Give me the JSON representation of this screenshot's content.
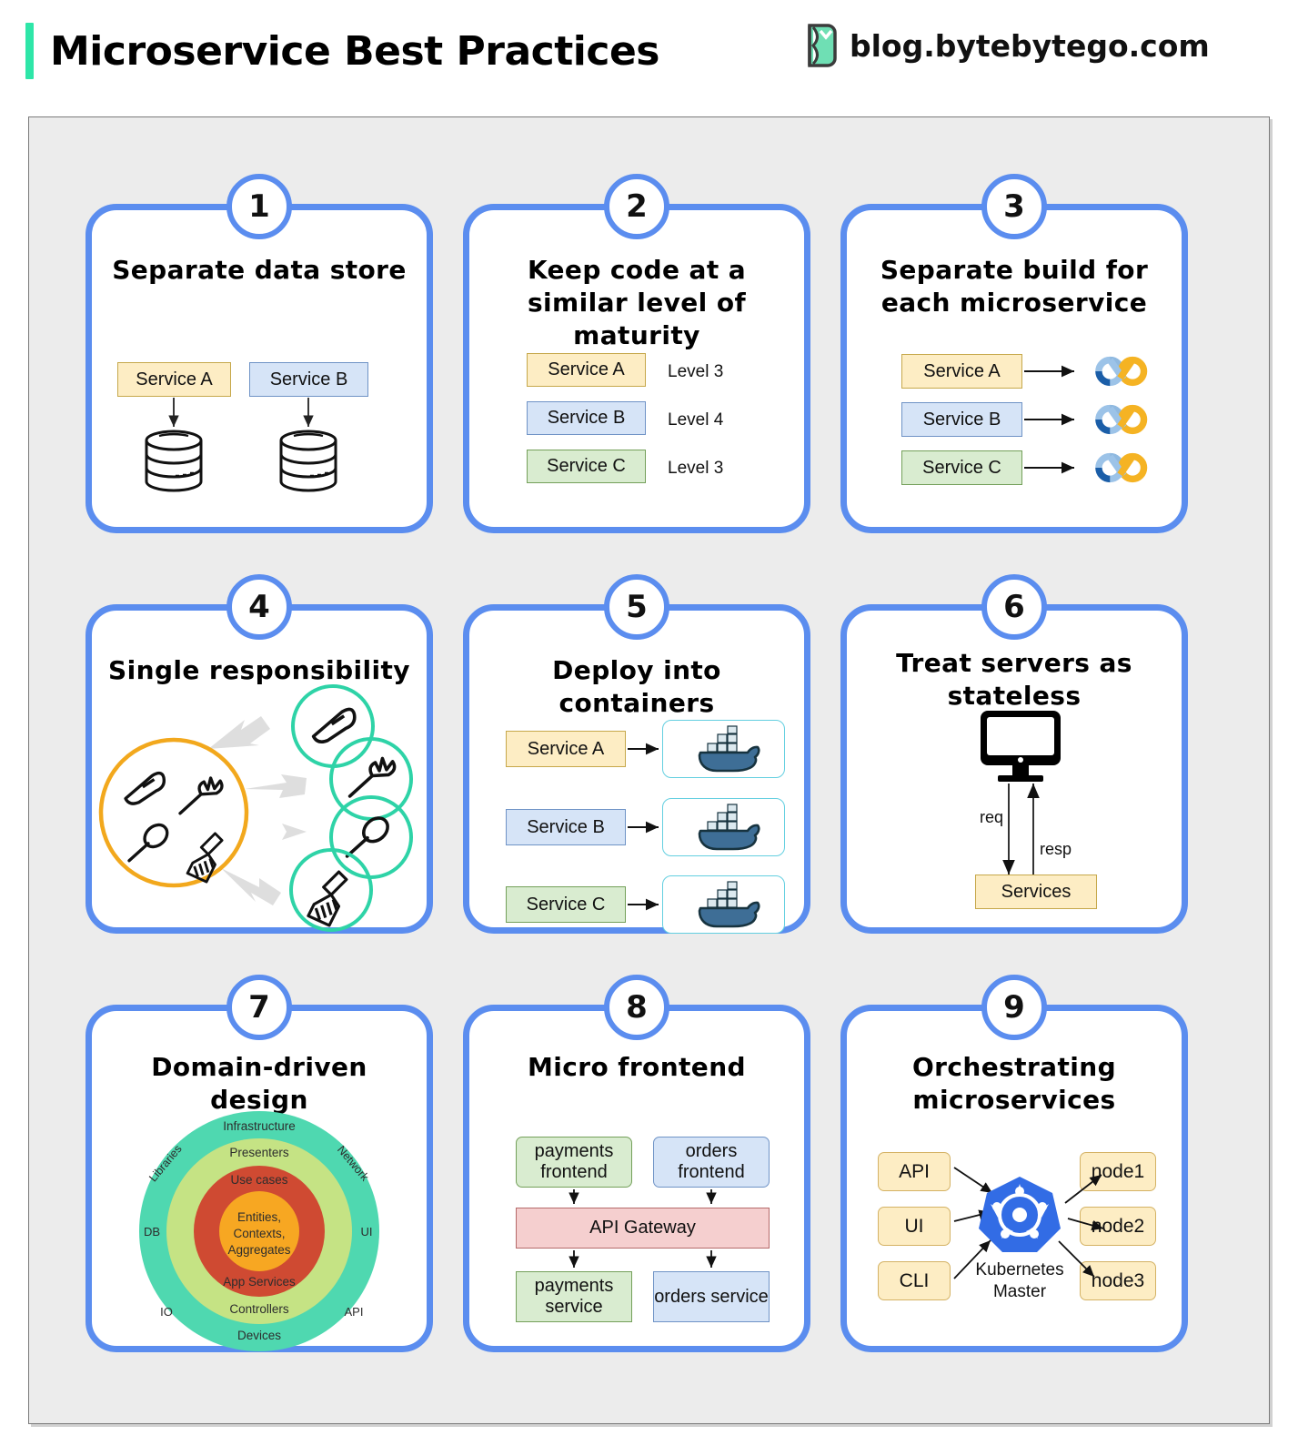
{
  "header": {
    "title": "Microservice Best Practices",
    "brand_text": "blog.bytebytego.com",
    "logo_icon": "bytebytego-logo-icon",
    "accent_color": "#2ee6a8"
  },
  "theme": {
    "card_border": "#5b8def",
    "frame_bg": "#ececec",
    "yellow": "#fdedc4",
    "blue": "#d6e4f7",
    "green": "#d9ecd0",
    "red": "#f5cfcf"
  },
  "cards": [
    {
      "number": "1",
      "title": "Separate data store",
      "services": [
        {
          "label": "Service A",
          "color": "yellow"
        },
        {
          "label": "Service B",
          "color": "blue"
        }
      ],
      "icons": [
        "database-cylinder-icon",
        "database-cylinder-icon"
      ]
    },
    {
      "number": "2",
      "title": "Keep code at a similar level of maturity",
      "rows": [
        {
          "label": "Service A",
          "color": "yellow",
          "level": "Level 3"
        },
        {
          "label": "Service B",
          "color": "blue",
          "level": "Level 4"
        },
        {
          "label": "Service C",
          "color": "green",
          "level": "Level 3"
        }
      ]
    },
    {
      "number": "3",
      "title": "Separate build for each microservice",
      "rows": [
        {
          "label": "Service A",
          "color": "yellow",
          "icon": "cicd-infinity-icon"
        },
        {
          "label": "Service B",
          "color": "blue",
          "icon": "cicd-infinity-icon"
        },
        {
          "label": "Service C",
          "color": "green",
          "icon": "cicd-infinity-icon"
        }
      ]
    },
    {
      "number": "4",
      "title": "Single responsibility",
      "source_icons": [
        "knife-icon",
        "fork-icon",
        "spoon-icon",
        "broom-icon"
      ],
      "target_icons": [
        "knife-icon",
        "fork-icon",
        "spoon-icon",
        "broom-icon"
      ],
      "source_ring_color": "#f2a81d",
      "target_ring_color": "#2ed3a7"
    },
    {
      "number": "5",
      "title": "Deploy into containers",
      "rows": [
        {
          "label": "Service A",
          "color": "yellow",
          "icon": "docker-whale-icon"
        },
        {
          "label": "Service B",
          "color": "blue",
          "icon": "docker-whale-icon"
        },
        {
          "label": "Service C",
          "color": "green",
          "icon": "docker-whale-icon"
        }
      ]
    },
    {
      "number": "6",
      "title": "Treat servers as stateless",
      "client_icon": "monitor-icon",
      "req_label": "req",
      "resp_label": "resp",
      "services_label": "Services"
    },
    {
      "number": "7",
      "title": "Domain-driven design",
      "onion": {
        "center": "Entities, Contexts, Aggregates",
        "rings": [
          {
            "name": "Use cases",
            "bottom": "App Services",
            "color": "#cf4a32"
          },
          {
            "name": "Presenters",
            "bottom": "Controllers",
            "color": "#c5e384"
          },
          {
            "name": "Infrastructure",
            "bottom": "Devices",
            "color": "#4fd8b0"
          }
        ],
        "side_labels": [
          "Libraries",
          "DB",
          "IO",
          "Network",
          "UI",
          "API"
        ],
        "center_color": "#f7a722"
      }
    },
    {
      "number": "8",
      "title": "Micro frontend",
      "frontends": [
        {
          "label": "payments frontend",
          "color": "green"
        },
        {
          "label": "orders frontend",
          "color": "blue"
        }
      ],
      "gateway": {
        "label": "API Gateway",
        "color": "red"
      },
      "backends": [
        {
          "label": "payments service",
          "color": "green"
        },
        {
          "label": "orders service",
          "color": "blue"
        }
      ]
    },
    {
      "number": "9",
      "title": "Orchestrating microservices",
      "clients": [
        "API",
        "UI",
        "CLI"
      ],
      "master_label": "Kubernetes Master",
      "master_icon": "kubernetes-helm-icon",
      "nodes": [
        "node1",
        "node2",
        "node3"
      ]
    }
  ]
}
